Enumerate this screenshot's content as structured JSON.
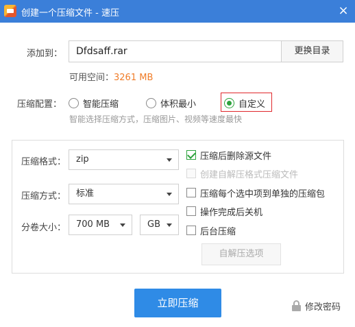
{
  "window": {
    "title": "创建一个压缩文件 - 速压",
    "close_glyph": "×"
  },
  "add_to": {
    "label": "添加到：",
    "filename": "Dfdsaff.rar",
    "browse_label": "更换目录",
    "space_label": "可用空间：",
    "space_value": "3261 MB"
  },
  "config": {
    "label": "压缩配置：",
    "options": [
      {
        "label": "智能压缩",
        "selected": false
      },
      {
        "label": "体积最小",
        "selected": false
      },
      {
        "label": "自定义",
        "selected": true
      }
    ],
    "hint": "智能选择压缩方式，压缩图片、视频等速度最快"
  },
  "panel": {
    "format_label": "压缩格式：",
    "format_value": "zip",
    "method_label": "压缩方式：",
    "method_value": "标准",
    "volume_label": "分卷大小：",
    "volume_size": "700 MB",
    "volume_unit": "GB",
    "checkboxes": [
      {
        "label": "压缩后删除源文件",
        "checked": true,
        "disabled": false
      },
      {
        "label": "创建自解压格式压缩文件",
        "checked": false,
        "disabled": true
      },
      {
        "label": "压缩每个选中项到单独的压缩包",
        "checked": false,
        "disabled": false
      },
      {
        "label": "操作完成后关机",
        "checked": false,
        "disabled": false
      },
      {
        "label": "后台压缩",
        "checked": false,
        "disabled": false
      }
    ],
    "sfx_button": "自解压选项"
  },
  "footer": {
    "compress_button": "立即压缩",
    "password_link": "修改密码"
  },
  "colors": {
    "titlebar": "#3b7fd9",
    "primary_button": "#2f8be6",
    "accent_orange": "#f07c28",
    "check_green": "#2da23c",
    "highlight_red": "#e0262a"
  },
  "icons": {
    "app": "app-logo-icon",
    "close": "close-icon",
    "dropdown": "chevron-down-icon",
    "lock": "lock-icon"
  }
}
